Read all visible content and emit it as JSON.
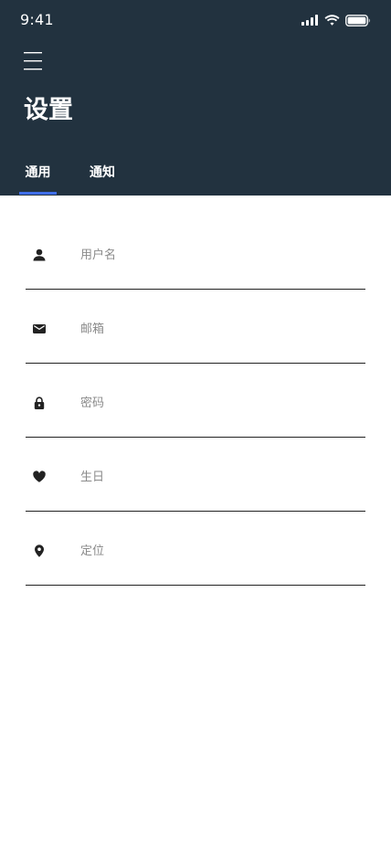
{
  "status_bar": {
    "time": "9:41"
  },
  "header": {
    "title": "设置"
  },
  "tabs": [
    {
      "label": "通用",
      "active": true
    },
    {
      "label": "通知",
      "active": false
    }
  ],
  "colors": {
    "header_bg": "#22323f",
    "tab_indicator": "#3f6ee8"
  },
  "form": {
    "fields": [
      {
        "icon": "user-icon",
        "placeholder": "用户名",
        "value": ""
      },
      {
        "icon": "mail-icon",
        "placeholder": "邮箱",
        "value": ""
      },
      {
        "icon": "lock-icon",
        "placeholder": "密码",
        "value": ""
      },
      {
        "icon": "heart-icon",
        "placeholder": "生日",
        "value": ""
      },
      {
        "icon": "location-pin-icon",
        "placeholder": "定位",
        "value": ""
      }
    ]
  }
}
